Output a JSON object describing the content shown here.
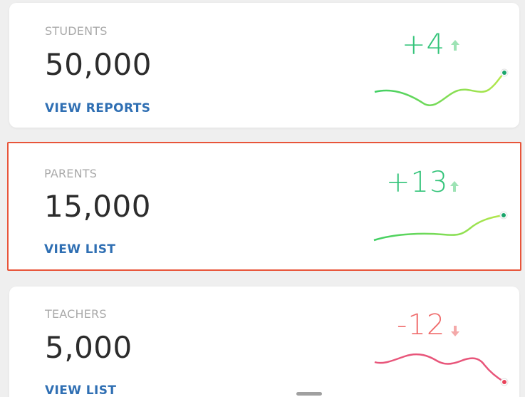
{
  "cards": [
    {
      "label": "STUDENTS",
      "value": "50,000",
      "link": "VIEW REPORTS",
      "delta": "+4",
      "trend": "up",
      "trend_icon": "arrow-up-icon",
      "colors": {
        "delta": "#34c47a",
        "line_start": "#3fcf63",
        "line_end": "#b6e84a",
        "dot": "#1aa56b"
      }
    },
    {
      "label": "PARENTS",
      "value": "15,000",
      "link": "VIEW LIST",
      "delta": "+13",
      "trend": "up",
      "trend_icon": "arrow-up-icon",
      "selected": true,
      "colors": {
        "delta": "#34c47a",
        "line_start": "#3fcf63",
        "line_end": "#b6e84a",
        "dot": "#1aa56b"
      }
    },
    {
      "label": "TEACHERS",
      "value": "5,000",
      "link": "VIEW LIST",
      "delta": "-12",
      "trend": "down",
      "trend_icon": "arrow-down-icon",
      "colors": {
        "delta": "#ef6b6b",
        "line_start": "#e8557a",
        "line_end": "#e8557a",
        "dot": "#e8435a"
      }
    }
  ],
  "accent": {
    "link": "#2f6fb3",
    "selection_border": "#e8553a"
  }
}
